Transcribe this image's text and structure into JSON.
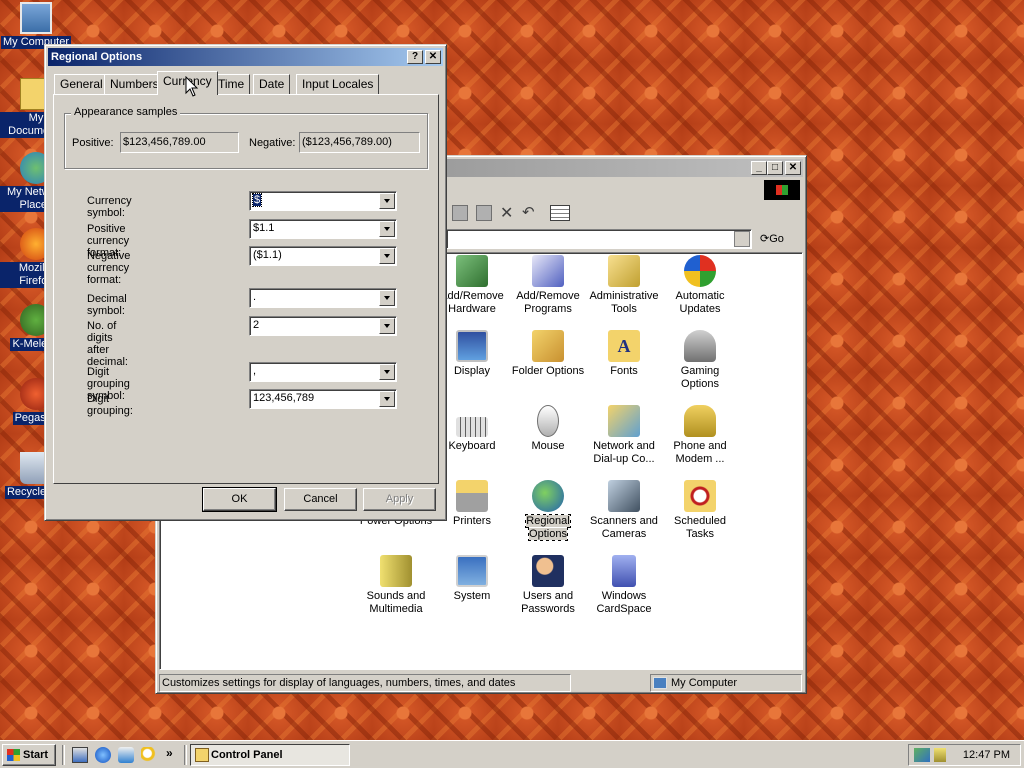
{
  "desktop": {
    "icons": [
      {
        "label": "My Computer"
      },
      {
        "label": "My Documents"
      },
      {
        "label": "My Network Places"
      },
      {
        "label": "Mozilla Firefox"
      },
      {
        "label": "K-Meleon"
      },
      {
        "label": "Pegasus"
      },
      {
        "label": "Recycle Bin"
      }
    ]
  },
  "control_panel": {
    "go_label": "Go",
    "icons": [
      {
        "label": "Add/Remove Hardware"
      },
      {
        "label": "Add/Remove Programs"
      },
      {
        "label": "Administrative Tools"
      },
      {
        "label": "Automatic Updates"
      },
      {
        "label": "Display"
      },
      {
        "label": "Folder Options"
      },
      {
        "label": "Fonts"
      },
      {
        "label": "Gaming Options"
      },
      {
        "label": "Keyboard"
      },
      {
        "label": "Mouse"
      },
      {
        "label": "Network and Dial-up Co..."
      },
      {
        "label": "Phone and Modem ..."
      },
      {
        "label": "Power Options"
      },
      {
        "label": "Printers"
      },
      {
        "label": "Regional Options"
      },
      {
        "label": "Scanners and Cameras"
      },
      {
        "label": "Scheduled Tasks"
      },
      {
        "label": "Sounds and Multimedia"
      },
      {
        "label": "System"
      },
      {
        "label": "Users and Passwords"
      },
      {
        "label": "Windows CardSpace"
      }
    ],
    "status_text": "Customizes settings for display of languages, numbers, times, and dates",
    "status_zone": "My Computer"
  },
  "dialog": {
    "title": "Regional Options",
    "help_label": "?",
    "close_label": "✕",
    "tabs": [
      "General",
      "Numbers",
      "Currency",
      "Time",
      "Date",
      "Input Locales"
    ],
    "active_tab": "Currency",
    "samples": {
      "group_label": "Appearance samples",
      "positive_label": "Positive:",
      "positive_value": "$123,456,789.00",
      "negative_label": "Negative:",
      "negative_value": "($123,456,789.00)"
    },
    "fields": {
      "currency_symbol": {
        "label": "Currency symbol:",
        "value": "$"
      },
      "positive_format": {
        "label": "Positive currency format:",
        "value": "$1.1"
      },
      "negative_format": {
        "label": "Negative currency format:",
        "value": "($1.1)"
      },
      "decimal_symbol": {
        "label": "Decimal symbol:",
        "value": "."
      },
      "digits_after_decimal": {
        "label": "No. of digits after decimal:",
        "value": "2"
      },
      "digit_grouping_symbol": {
        "label": "Digit grouping symbol:",
        "value": ","
      },
      "digit_grouping": {
        "label": "Digit grouping:",
        "value": "123,456,789"
      }
    },
    "buttons": {
      "ok": "OK",
      "cancel": "Cancel",
      "apply": "Apply"
    }
  },
  "taskbar": {
    "start_label": "Start",
    "task_label": "Control Panel",
    "clock": "12:47 PM"
  },
  "colors": {
    "title_active": "#0a246a",
    "window_face": "#d4d0c8",
    "desktop": "#c8481e"
  }
}
